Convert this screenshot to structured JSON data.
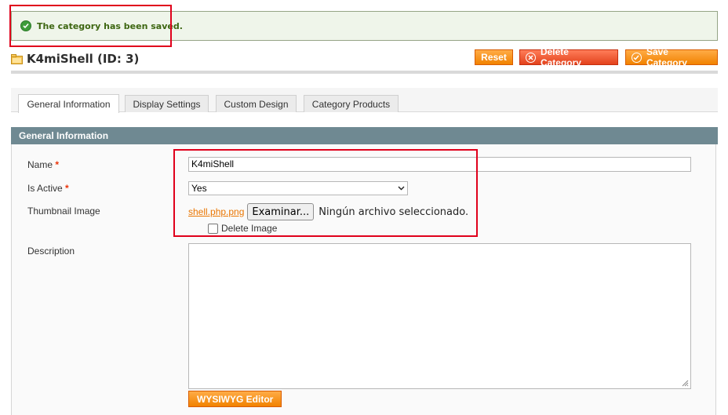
{
  "message": {
    "text": "The category has been saved.",
    "icon": "checkmark-icon"
  },
  "header": {
    "title": "K4miShell (ID: 3)",
    "icon": "folder-icon"
  },
  "actions": {
    "reset": "Reset",
    "delete": "Delete Category",
    "save": "Save Category"
  },
  "tabs": [
    "General Information",
    "Display Settings",
    "Custom Design",
    "Category Products"
  ],
  "section": {
    "title": "General Information"
  },
  "form": {
    "name_label": "Name",
    "name_value": "K4miShell",
    "is_active_label": "Is Active",
    "is_active_value": "Yes",
    "thumbnail_label": "Thumbnail Image",
    "thumbnail_file": "shell.php.png",
    "browse_label": "Examinar...",
    "no_file_text": "Ningún archivo seleccionado.",
    "delete_image_label": "Delete Image",
    "description_label": "Description",
    "required_mark": "*",
    "wysiwyg_label": "WYSIWYG Editor"
  },
  "colors": {
    "accent": "#f18200",
    "highlight": "#e0001b",
    "section_header": "#6f8992",
    "success_text": "#3d6611"
  }
}
